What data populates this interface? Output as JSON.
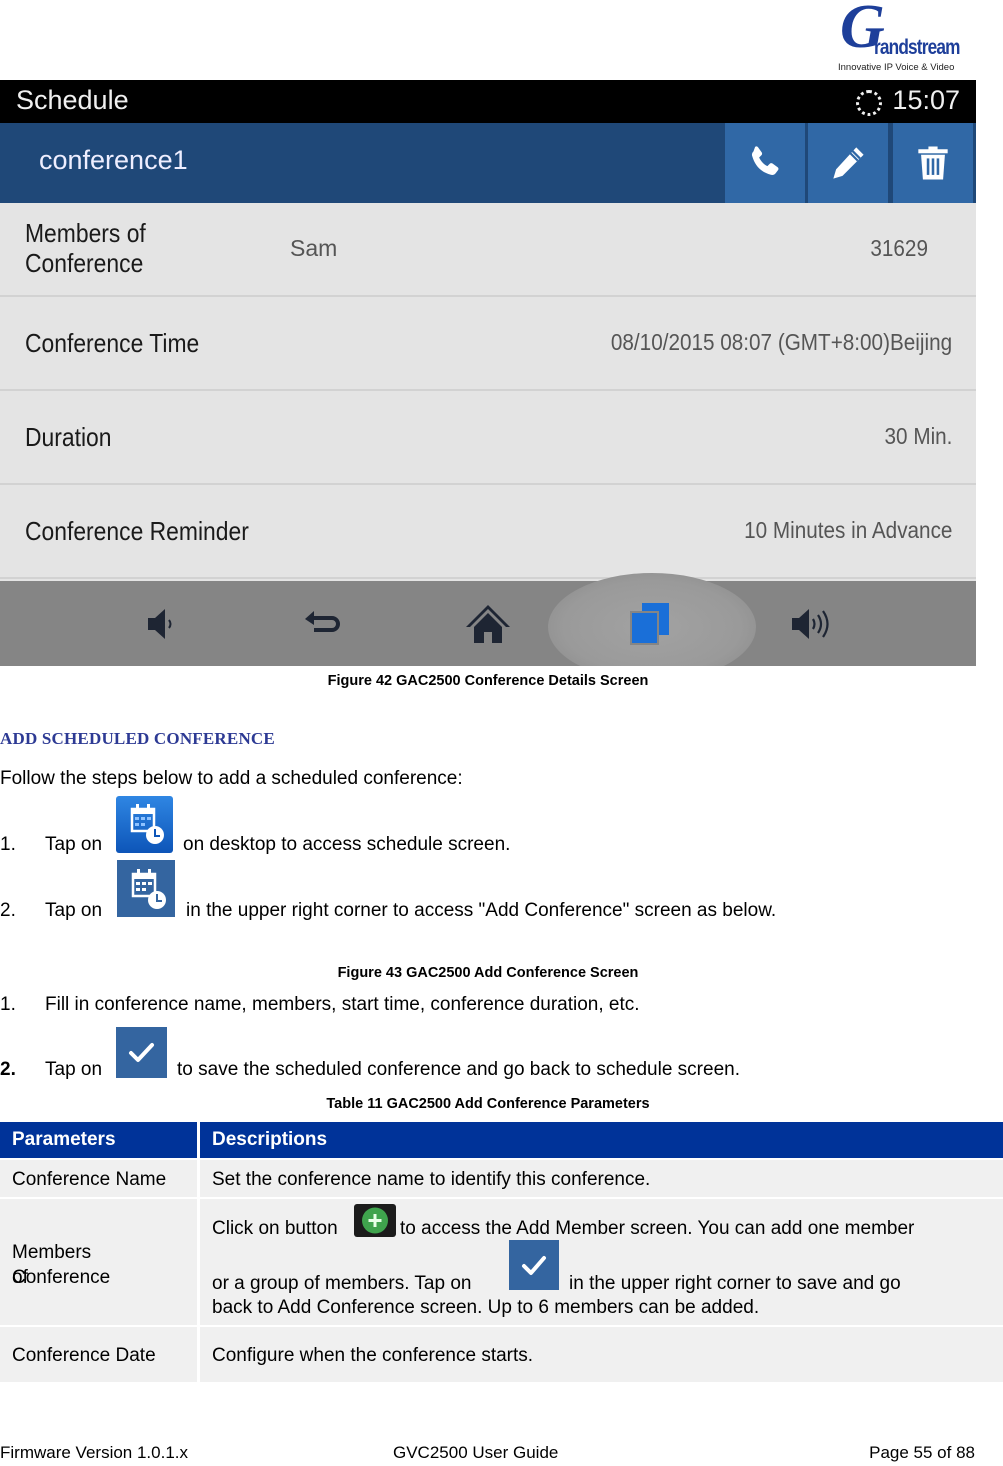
{
  "logo": {
    "brand": "randstream",
    "initial": "G",
    "tagline": "Innovative IP Voice & Video"
  },
  "device_screen": {
    "status_bar": {
      "title": "Schedule",
      "sync_icon": "sync-icon",
      "time": "15:07"
    },
    "action_bar": {
      "conference_name": "conference1",
      "buttons": [
        {
          "name": "call",
          "icon": "phone-icon"
        },
        {
          "name": "edit",
          "icon": "pencil-icon"
        },
        {
          "name": "delete",
          "icon": "trash-icon"
        }
      ],
      "colors": {
        "bar": "#1f4878",
        "button": "#3068a6"
      }
    },
    "details": [
      {
        "label_line1": "Members of",
        "label_line2": "Conference",
        "member_name": "Sam",
        "value": "31629"
      },
      {
        "label": "Conference Time",
        "value": "08/10/2015 08:07 (GMT+8:00)Beijing"
      },
      {
        "label": "Duration",
        "value": "30 Min."
      },
      {
        "label": "Conference Reminder",
        "value": "10 Minutes in Advance"
      }
    ],
    "nav_bar": [
      {
        "name": "volume-down",
        "icon": "volume-down-icon"
      },
      {
        "name": "back",
        "icon": "back-icon"
      },
      {
        "name": "home",
        "icon": "home-icon"
      },
      {
        "name": "recent-apps",
        "icon": "recent-apps-icon",
        "active": true
      },
      {
        "name": "volume-up",
        "icon": "volume-up-icon"
      }
    ]
  },
  "figure42_caption": "Figure 42 GAC2500 Conference Details Screen",
  "section_heading": "ADD SCHEDULED CONFERENCE",
  "intro": "Follow the steps below to add a scheduled conference:",
  "steps_a": [
    {
      "num": "1.",
      "pre": "Tap on",
      "icon": "schedule-app-icon",
      "post": "on desktop to access schedule screen."
    },
    {
      "num": "2.",
      "pre": "Tap on",
      "icon": "add-schedule-icon",
      "post": "in the upper right corner to access \"Add Conference\" screen as below."
    }
  ],
  "figure43_caption": "Figure 43 GAC2500 Add Conference Screen",
  "steps_b": [
    {
      "num": "1.",
      "text": "Fill in conference name, members, start time, conference duration, etc."
    },
    {
      "num": "2.",
      "pre": "Tap on",
      "icon": "checkmark-icon",
      "post": "to save the scheduled conference and go back to schedule screen."
    }
  ],
  "table11_caption": "Table 11 GAC2500 Add Conference Parameters",
  "table": {
    "headers": [
      "Parameters",
      "Descriptions"
    ],
    "header_color": "#003399",
    "rows": [
      {
        "param": "Conference Name",
        "desc": "Set the conference name to identify this conference."
      },
      {
        "param_line1": "Members of",
        "param_line2": "Conference",
        "desc_a": "Click on button",
        "desc_b": "to access the Add Member screen. You can add one member",
        "desc_c": "or a group of members. Tap on",
        "desc_d": "in the upper right corner to save and go",
        "desc_e": "back to Add Conference screen. Up to 6 members can be added."
      },
      {
        "param": "Conference Date",
        "desc": "Configure when the conference starts."
      }
    ]
  },
  "footer": {
    "left": "Firmware Version 1.0.1.x",
    "center": "GVC2500 User Guide",
    "right": "Page 55 of 88"
  }
}
